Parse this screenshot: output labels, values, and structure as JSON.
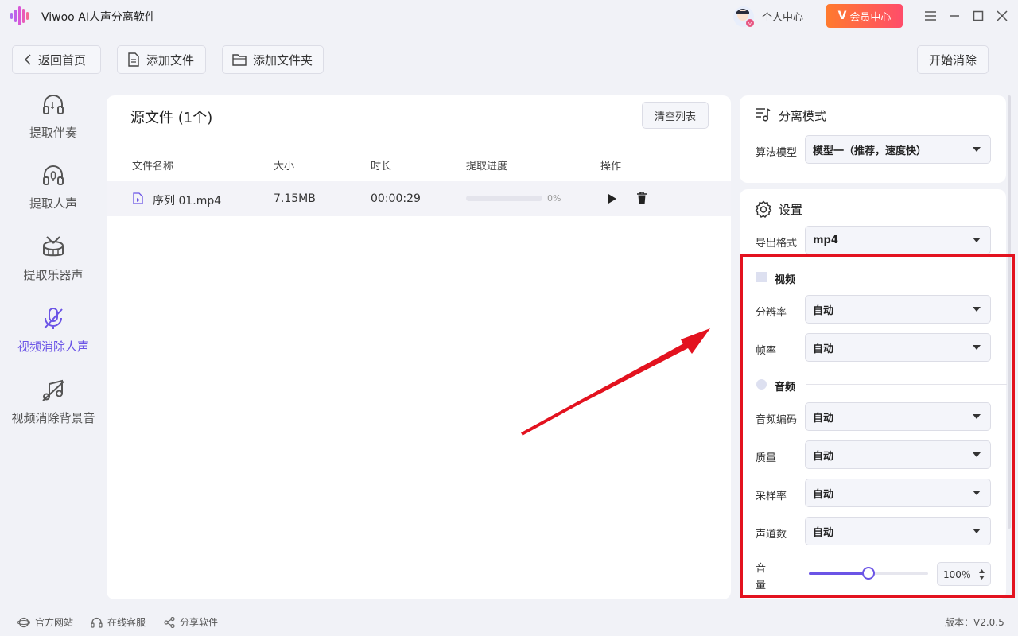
{
  "app": {
    "title": "Viwoo AI人声分离软件"
  },
  "header": {
    "personal_label": "个人中心",
    "vip_label": "会员中心",
    "vip_letter": "V"
  },
  "toolbar": {
    "back_label": "返回首页",
    "add_file_label": "添加文件",
    "add_folder_label": "添加文件夹",
    "start_label": "开始消除"
  },
  "sidebar": {
    "items": [
      {
        "label": "提取伴奏",
        "icon": "headphones-icon"
      },
      {
        "label": "提取人声",
        "icon": "headphones-mic-icon"
      },
      {
        "label": "提取乐器声",
        "icon": "drum-icon"
      },
      {
        "label": "视频消除人声",
        "icon": "mic-off-icon",
        "active": true
      },
      {
        "label": "视频消除背景音",
        "icon": "music-off-icon"
      }
    ]
  },
  "main": {
    "title": "源文件 (1个)",
    "clear_label": "清空列表",
    "columns": [
      "文件名称",
      "大小",
      "时长",
      "提取进度",
      "操作"
    ],
    "rows": [
      {
        "name": "序列 01.mp4",
        "size": "7.15MB",
        "duration": "00:00:29",
        "progress": 0,
        "progress_text": "0%"
      }
    ]
  },
  "mode": {
    "title": "分离模式",
    "model_label": "算法模型",
    "model_value": "模型一（推荐，速度快）"
  },
  "settings": {
    "title": "设置",
    "format_label": "导出格式",
    "format_value": "mp4",
    "video": {
      "title": "视频",
      "resolution_label": "分辨率",
      "resolution_value": "自动",
      "fps_label": "帧率",
      "fps_value": "自动"
    },
    "audio": {
      "title": "音频",
      "codec_label": "音频编码",
      "codec_value": "自动",
      "quality_label": "质量",
      "quality_value": "自动",
      "samplerate_label": "采样率",
      "samplerate_value": "自动",
      "channels_label": "声道数",
      "channels_value": "自动",
      "volume_label_1": "音",
      "volume_label_2": "量",
      "volume_value": 0.5,
      "volume_text": "100％"
    }
  },
  "footer": {
    "website": "官方网站",
    "support": "在线客服",
    "share": "分享软件",
    "version": "版本：V2.0.5"
  },
  "colors": {
    "accent": "#6b54e6",
    "highlight_box": "#e3121f",
    "vip_start": "#ff7a2e",
    "vip_end": "#ff4d6a"
  }
}
